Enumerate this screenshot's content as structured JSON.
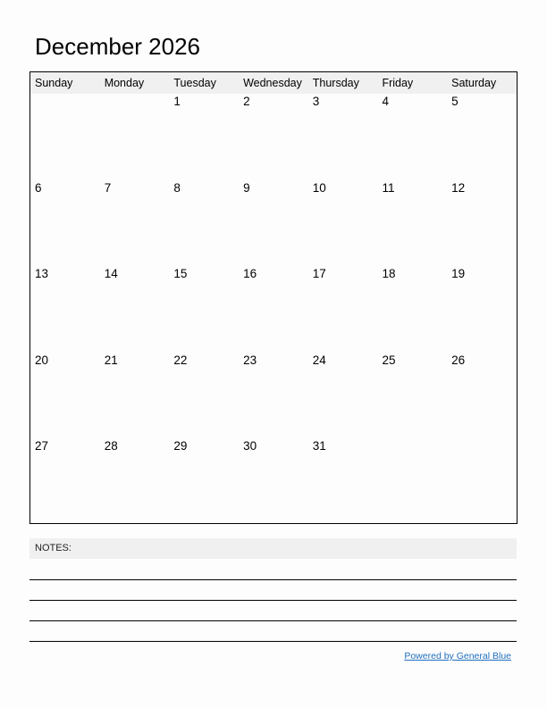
{
  "title": "December 2026",
  "weekdays": [
    "Sunday",
    "Monday",
    "Tuesday",
    "Wednesday",
    "Thursday",
    "Friday",
    "Saturday"
  ],
  "weeks": [
    [
      "",
      "",
      "1",
      "2",
      "3",
      "4",
      "5"
    ],
    [
      "6",
      "7",
      "8",
      "9",
      "10",
      "11",
      "12"
    ],
    [
      "13",
      "14",
      "15",
      "16",
      "17",
      "18",
      "19"
    ],
    [
      "20",
      "21",
      "22",
      "23",
      "24",
      "25",
      "26"
    ],
    [
      "27",
      "28",
      "29",
      "30",
      "31",
      "",
      ""
    ]
  ],
  "notes_label": "NOTES:",
  "notes_line_count": 4,
  "footer_link": "Powered by General Blue",
  "colors": {
    "header_bg": "#f0f0f0",
    "link": "#1f6fbf"
  }
}
